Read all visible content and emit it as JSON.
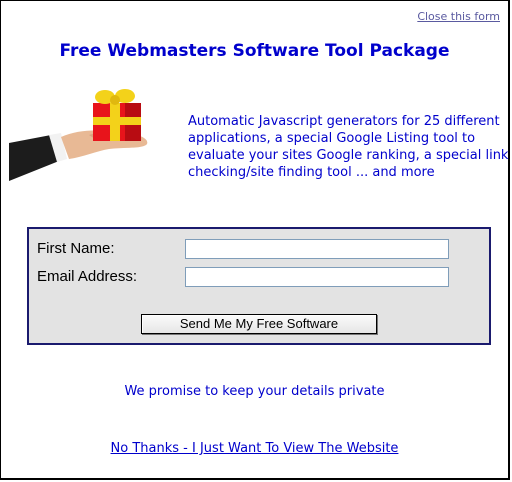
{
  "header": {
    "close_label": "Close this form"
  },
  "title": "Free Webmasters Software Tool Package",
  "description": "Automatic Javascript generators for 25 different applications, a special Google Listing tool to evaluate your sites Google ranking, a special link checking/site finding tool ... and more",
  "hero": {
    "icon": "gift-in-hand-icon",
    "colors": {
      "box": "#e8141b",
      "ribbon": "#f3d21a",
      "cuff": "#1c1c1c"
    }
  },
  "form": {
    "first_name_label": "First Name:",
    "first_name_value": "",
    "email_label": "Email Address:",
    "email_value": "",
    "submit_label": "Send Me My Free Software"
  },
  "privacy_note": "We promise to keep your details private",
  "decline_link": "No Thanks - I Just Want To View The Website",
  "colors": {
    "text_blue": "#0000cc",
    "form_bg": "#e3e3e3",
    "form_border": "#1a1a6e"
  }
}
